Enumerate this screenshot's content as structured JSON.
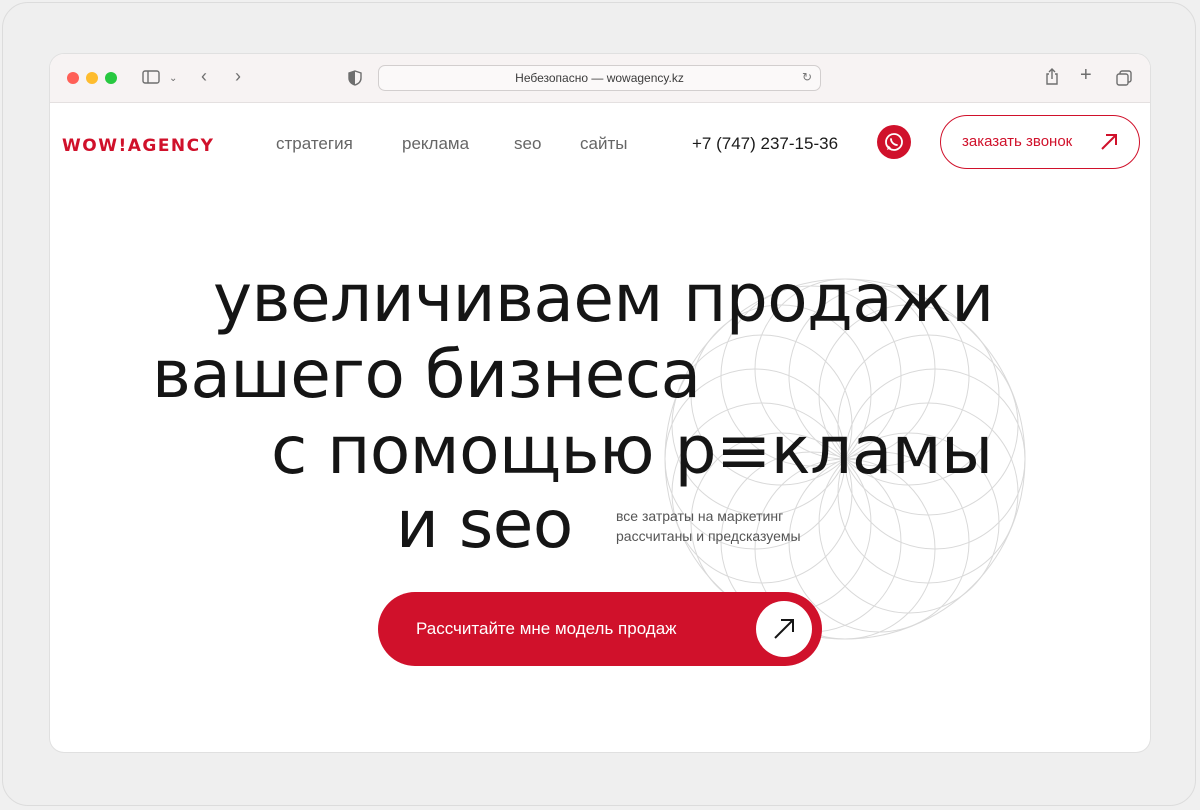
{
  "browser": {
    "url_text": "Небезопасно — wowagency.kz"
  },
  "site": {
    "logo": "WOW!AGENCY",
    "nav": [
      "стратегия",
      "реклама",
      "seo",
      "сайты"
    ],
    "phone": "+7 (747) 237-15-36",
    "call_button": "заказать звонок"
  },
  "hero": {
    "line1": "увеличиваем продажи",
    "line2": "вашего бизнеса",
    "line3": "с помощью р≡кламы",
    "line4": "и seo",
    "subtext_line1": "все затраты на маркетинг",
    "subtext_line2": "рассчитаны и предсказуемы",
    "cta_label": "Рассчитайте мне модель продаж"
  },
  "colors": {
    "brand_red": "#d0112b",
    "text": "#151515"
  },
  "icons": {
    "whatsapp": "whatsapp-icon",
    "arrow": "arrow-up-right-icon"
  }
}
